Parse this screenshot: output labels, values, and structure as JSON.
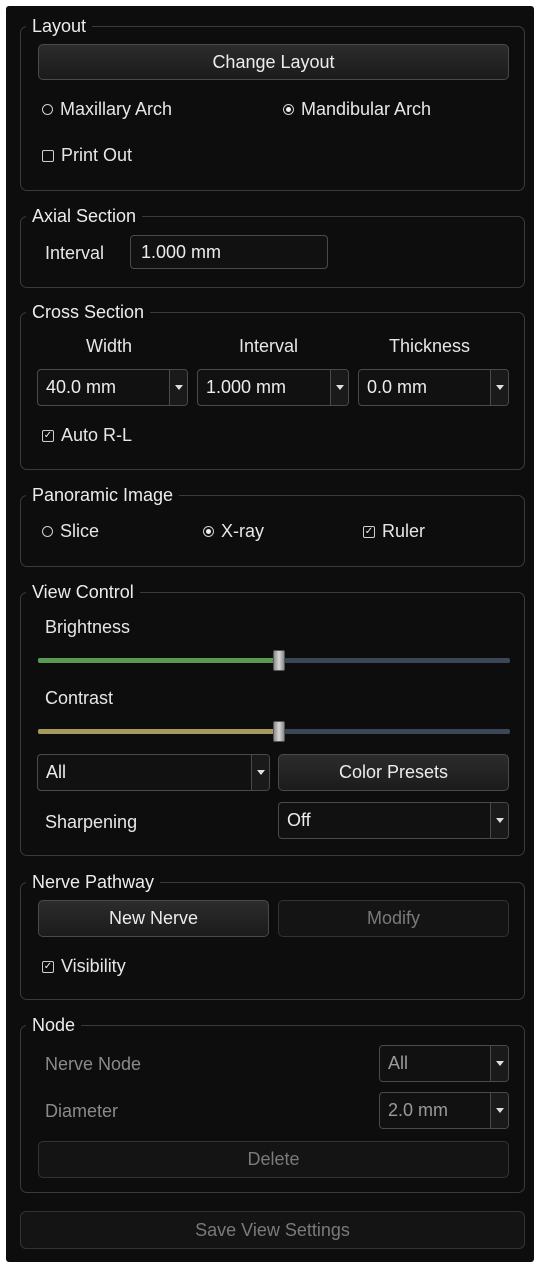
{
  "layout": {
    "title": "Layout",
    "change_layout": "Change Layout",
    "maxillary": "Maxillary Arch",
    "mandibular": "Mandibular Arch",
    "selected_arch": "Mandibular Arch",
    "print_out": "Print Out",
    "print_out_checked": false
  },
  "axial": {
    "title": "Axial Section",
    "interval_label": "Interval",
    "interval_value": "1.000 mm"
  },
  "cross": {
    "title": "Cross Section",
    "width_label": "Width",
    "interval_label": "Interval",
    "thickness_label": "Thickness",
    "width_value": "40.0 mm",
    "interval_value": "1.000 mm",
    "thickness_value": "0.0 mm",
    "auto_rl": "Auto R-L",
    "auto_rl_checked": true
  },
  "panoramic": {
    "title": "Panoramic Image",
    "slice": "Slice",
    "xray": "X-ray",
    "selected": "X-ray",
    "ruler": "Ruler",
    "ruler_checked": true
  },
  "view": {
    "title": "View Control",
    "brightness_label": "Brightness",
    "brightness_level": 0.51,
    "brightness_color": "#5a9a55",
    "contrast_label": "Contrast",
    "contrast_level": 0.51,
    "contrast_color": "#a79a5e",
    "channel_value": "All",
    "color_presets": "Color Presets",
    "sharpening_label": "Sharpening",
    "sharpening_value": "Off"
  },
  "nerve": {
    "title": "Nerve Pathway",
    "new_nerve": "New Nerve",
    "modify": "Modify",
    "visibility": "Visibility",
    "visibility_checked": true
  },
  "node": {
    "title": "Node",
    "nerve_node_label": "Nerve Node",
    "nerve_node_value": "All",
    "diameter_label": "Diameter",
    "diameter_value": "2.0 mm",
    "delete": "Delete"
  },
  "save_view_settings": "Save View Settings"
}
